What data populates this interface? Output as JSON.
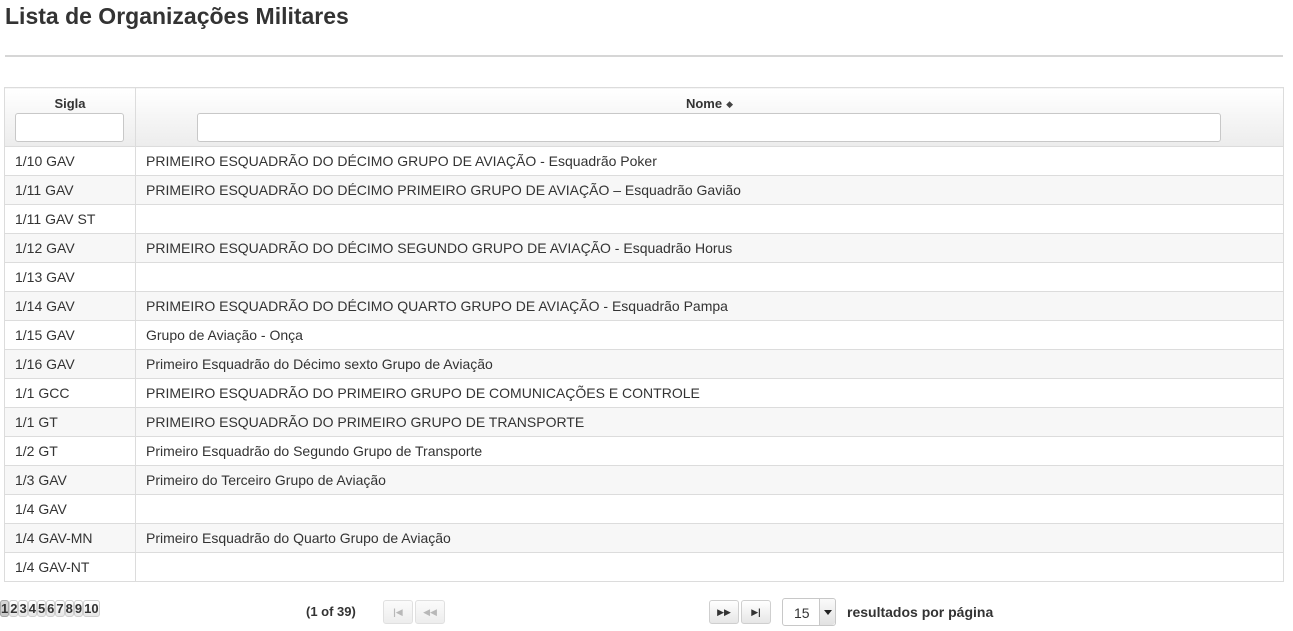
{
  "page": {
    "title": "Lista de Organizações Militares"
  },
  "table": {
    "columns": [
      {
        "label": "Sigla",
        "filter_value": ""
      },
      {
        "label": "Nome",
        "sort_icon": "sort-up-down-icon",
        "filter_value": ""
      }
    ],
    "rows": [
      {
        "sigla": "1/10 GAV",
        "nome": "PRIMEIRO ESQUADRÃO DO DÉCIMO GRUPO DE AVIAÇÃO - Esquadrão Poker"
      },
      {
        "sigla": "1/11 GAV",
        "nome": "PRIMEIRO ESQUADRÃO DO DÉCIMO PRIMEIRO GRUPO DE AVIAÇÃO – Esquadrão Gavião"
      },
      {
        "sigla": "1/11 GAV ST",
        "nome": ""
      },
      {
        "sigla": "1/12 GAV",
        "nome": "PRIMEIRO ESQUADRÃO DO DÉCIMO SEGUNDO GRUPO DE AVIAÇÃO - Esquadrão Horus"
      },
      {
        "sigla": "1/13 GAV",
        "nome": ""
      },
      {
        "sigla": "1/14 GAV",
        "nome": "PRIMEIRO ESQUADRÃO DO DÉCIMO QUARTO GRUPO DE AVIAÇÃO - Esquadrão Pampa"
      },
      {
        "sigla": "1/15 GAV",
        "nome": "Grupo de Aviação - Onça"
      },
      {
        "sigla": "1/16 GAV",
        "nome": "Primeiro Esquadrão do Décimo sexto Grupo de Aviação"
      },
      {
        "sigla": "1/1 GCC",
        "nome": "PRIMEIRO ESQUADRÃO DO PRIMEIRO GRUPO DE COMUNICAÇÕES E CONTROLE"
      },
      {
        "sigla": "1/1 GT",
        "nome": "PRIMEIRO ESQUADRÃO DO PRIMEIRO GRUPO DE TRANSPORTE"
      },
      {
        "sigla": "1/2 GT",
        "nome": "Primeiro Esquadrão do Segundo Grupo de Transporte"
      },
      {
        "sigla": "1/3 GAV",
        "nome": "Primeiro do Terceiro Grupo de Aviação"
      },
      {
        "sigla": "1/4 GAV",
        "nome": ""
      },
      {
        "sigla": "1/4 GAV-MN",
        "nome": "Primeiro Esquadrão do Quarto Grupo de Aviação"
      },
      {
        "sigla": "1/4 GAV-NT",
        "nome": ""
      }
    ]
  },
  "paginator": {
    "report": "(1 of 39)",
    "first_icon": "first-page-icon",
    "prev_icon": "previous-page-icon",
    "next_icon": "next-page-icon",
    "last_icon": "last-page-icon",
    "pages": [
      "1",
      "2",
      "3",
      "4",
      "5",
      "6",
      "7",
      "8",
      "9",
      "10"
    ],
    "current_page": "1",
    "rows_per_page": "15",
    "rows_per_page_label": "resultados por página",
    "dropdown_icon": "caret-down-icon"
  }
}
